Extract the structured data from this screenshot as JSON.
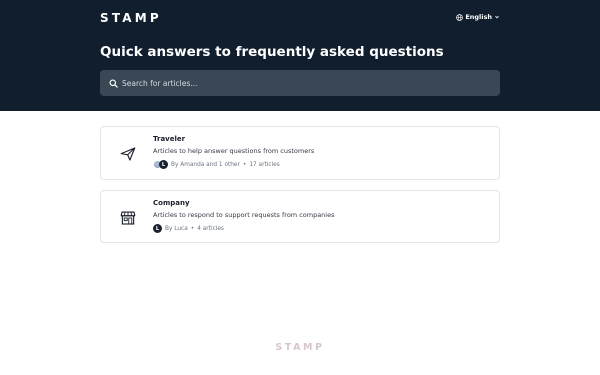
{
  "header": {
    "logo": "STAMP",
    "language": "English",
    "title": "Quick answers to frequently asked questions",
    "search_placeholder": "Search for articles..."
  },
  "collections": [
    {
      "title": "Traveler",
      "description": "Articles to help answer questions from customers",
      "authors": "By Amanda and 1 other",
      "separator": "•",
      "article_count": "17 articles",
      "avatar_letter": "L",
      "icon": "paper-plane-icon"
    },
    {
      "title": "Company",
      "description": "Articles to respond to support requests from companies",
      "authors": "By Luca",
      "separator": "•",
      "article_count": "4 articles",
      "avatar_letter": "L",
      "icon": "storefront-icon"
    }
  ],
  "footer": {
    "logo": "STAMP"
  }
}
